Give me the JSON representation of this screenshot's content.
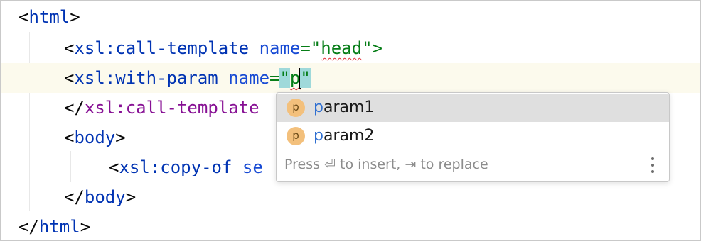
{
  "editor": {
    "lines": [
      {
        "lt": "<",
        "ns": "",
        "name": "html",
        "gt": ">"
      },
      {
        "lt": "<",
        "ns": "xsl",
        "sep": ":",
        "name": "call-template",
        "attr": "name",
        "eq": "=\"",
        "value": "head",
        "close": "\">"
      },
      {
        "lt": "<",
        "ns": "xsl",
        "sep": ":",
        "name": "with-param",
        "attr": "name",
        "eq": "=",
        "q1": "\"",
        "value": "p",
        "q2": "\""
      },
      {
        "lt": "</",
        "ns": "xsl",
        "sep": ":",
        "name": "call-template"
      },
      {
        "lt": "<",
        "name": "body",
        "gt": ">"
      },
      {
        "lt": "<",
        "ns": "xsl",
        "sep": ":",
        "name": "copy-of",
        "attr": "se"
      },
      {
        "lt": "</",
        "name": "body",
        "gt": ">"
      },
      {
        "lt": "</",
        "name": "html",
        "gt": ">"
      }
    ]
  },
  "completion": {
    "items": [
      {
        "icon": "p",
        "match": "p",
        "rest": "aram1",
        "selected": true
      },
      {
        "icon": "p",
        "match": "p",
        "rest": "aram2",
        "selected": false
      }
    ],
    "hint": "Press ⏎ to insert, ⇥ to replace"
  },
  "colors": {
    "tag": "#0033b3",
    "namespace": "#871094",
    "attribute": "#174ad4",
    "string": "#067d17",
    "current_line": "#fcfaed",
    "selected_item": "#dfdfdf",
    "param_icon": "#f3c07c",
    "error_squiggle": "#e0303a"
  }
}
